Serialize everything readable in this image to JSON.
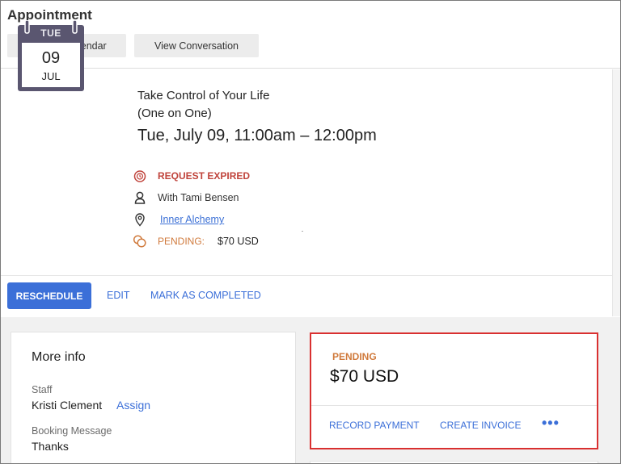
{
  "header": {
    "title": "Appointment",
    "view_calendar": "View on Calendar",
    "view_conversation": "View Conversation"
  },
  "appointment": {
    "calendar": {
      "dow": "TUE",
      "day": "09",
      "month": "JUL"
    },
    "title": "Take Control of Your Life",
    "subtitle": "(One on One)",
    "datetime": "Tue, July 09, 11:00am – 12:00pm",
    "status": "REQUEST EXPIRED",
    "with": "With Tami Bensen",
    "location": "Inner Alchemy",
    "payment_status": "PENDING:",
    "payment_amount": "$70 USD"
  },
  "actions": {
    "reschedule": "RESCHEDULE",
    "edit": "EDIT",
    "mark_completed": "MARK AS COMPLETED"
  },
  "more_info": {
    "title": "More info",
    "staff_label": "Staff",
    "staff_value": "Kristi Clement",
    "assign": "Assign",
    "booking_label": "Booking Message",
    "booking_value": "Thanks"
  },
  "payment": {
    "status": "PENDING",
    "amount": "$70 USD",
    "record": "RECORD PAYMENT",
    "invoice": "CREATE INVOICE",
    "more": "•••"
  },
  "colors": {
    "primary": "#3b6fd8",
    "expired": "#c0443c",
    "pending": "#d07a3c",
    "highlight": "#d93030",
    "calendar": "#5a5670"
  },
  "icons": {
    "calendar": "calendar-icon",
    "clock": "clock-alert-icon",
    "person": "person-icon",
    "location": "location-pin-icon",
    "coins": "coins-icon"
  }
}
